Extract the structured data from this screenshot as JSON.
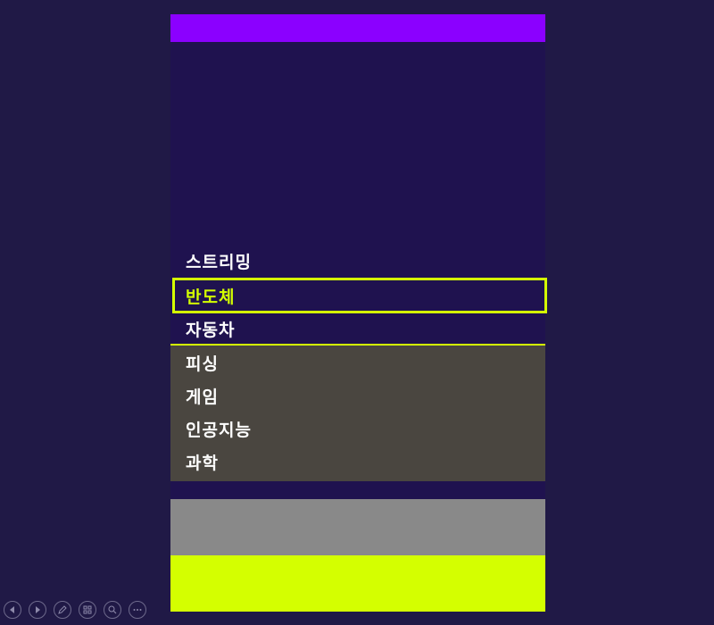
{
  "menu": {
    "items": [
      {
        "label": "스트리밍",
        "selected": false
      },
      {
        "label": "반도체",
        "selected": true
      },
      {
        "label": "자동차",
        "selected": false
      },
      {
        "label": "피싱",
        "selected": false
      },
      {
        "label": "게임",
        "selected": false
      },
      {
        "label": "인공지능",
        "selected": false
      },
      {
        "label": "과학",
        "selected": false
      }
    ]
  },
  "colors": {
    "background": "#201946",
    "slide": "#1f124f",
    "top_bar": "#8b00ff",
    "accent": "#d4ff00",
    "dark_panel": "#4a4640",
    "gray_bar": "#898989"
  },
  "controls": {
    "icons": [
      "previous-icon",
      "next-icon",
      "pen-icon",
      "slides-grid-icon",
      "zoom-icon",
      "more-icon"
    ]
  }
}
